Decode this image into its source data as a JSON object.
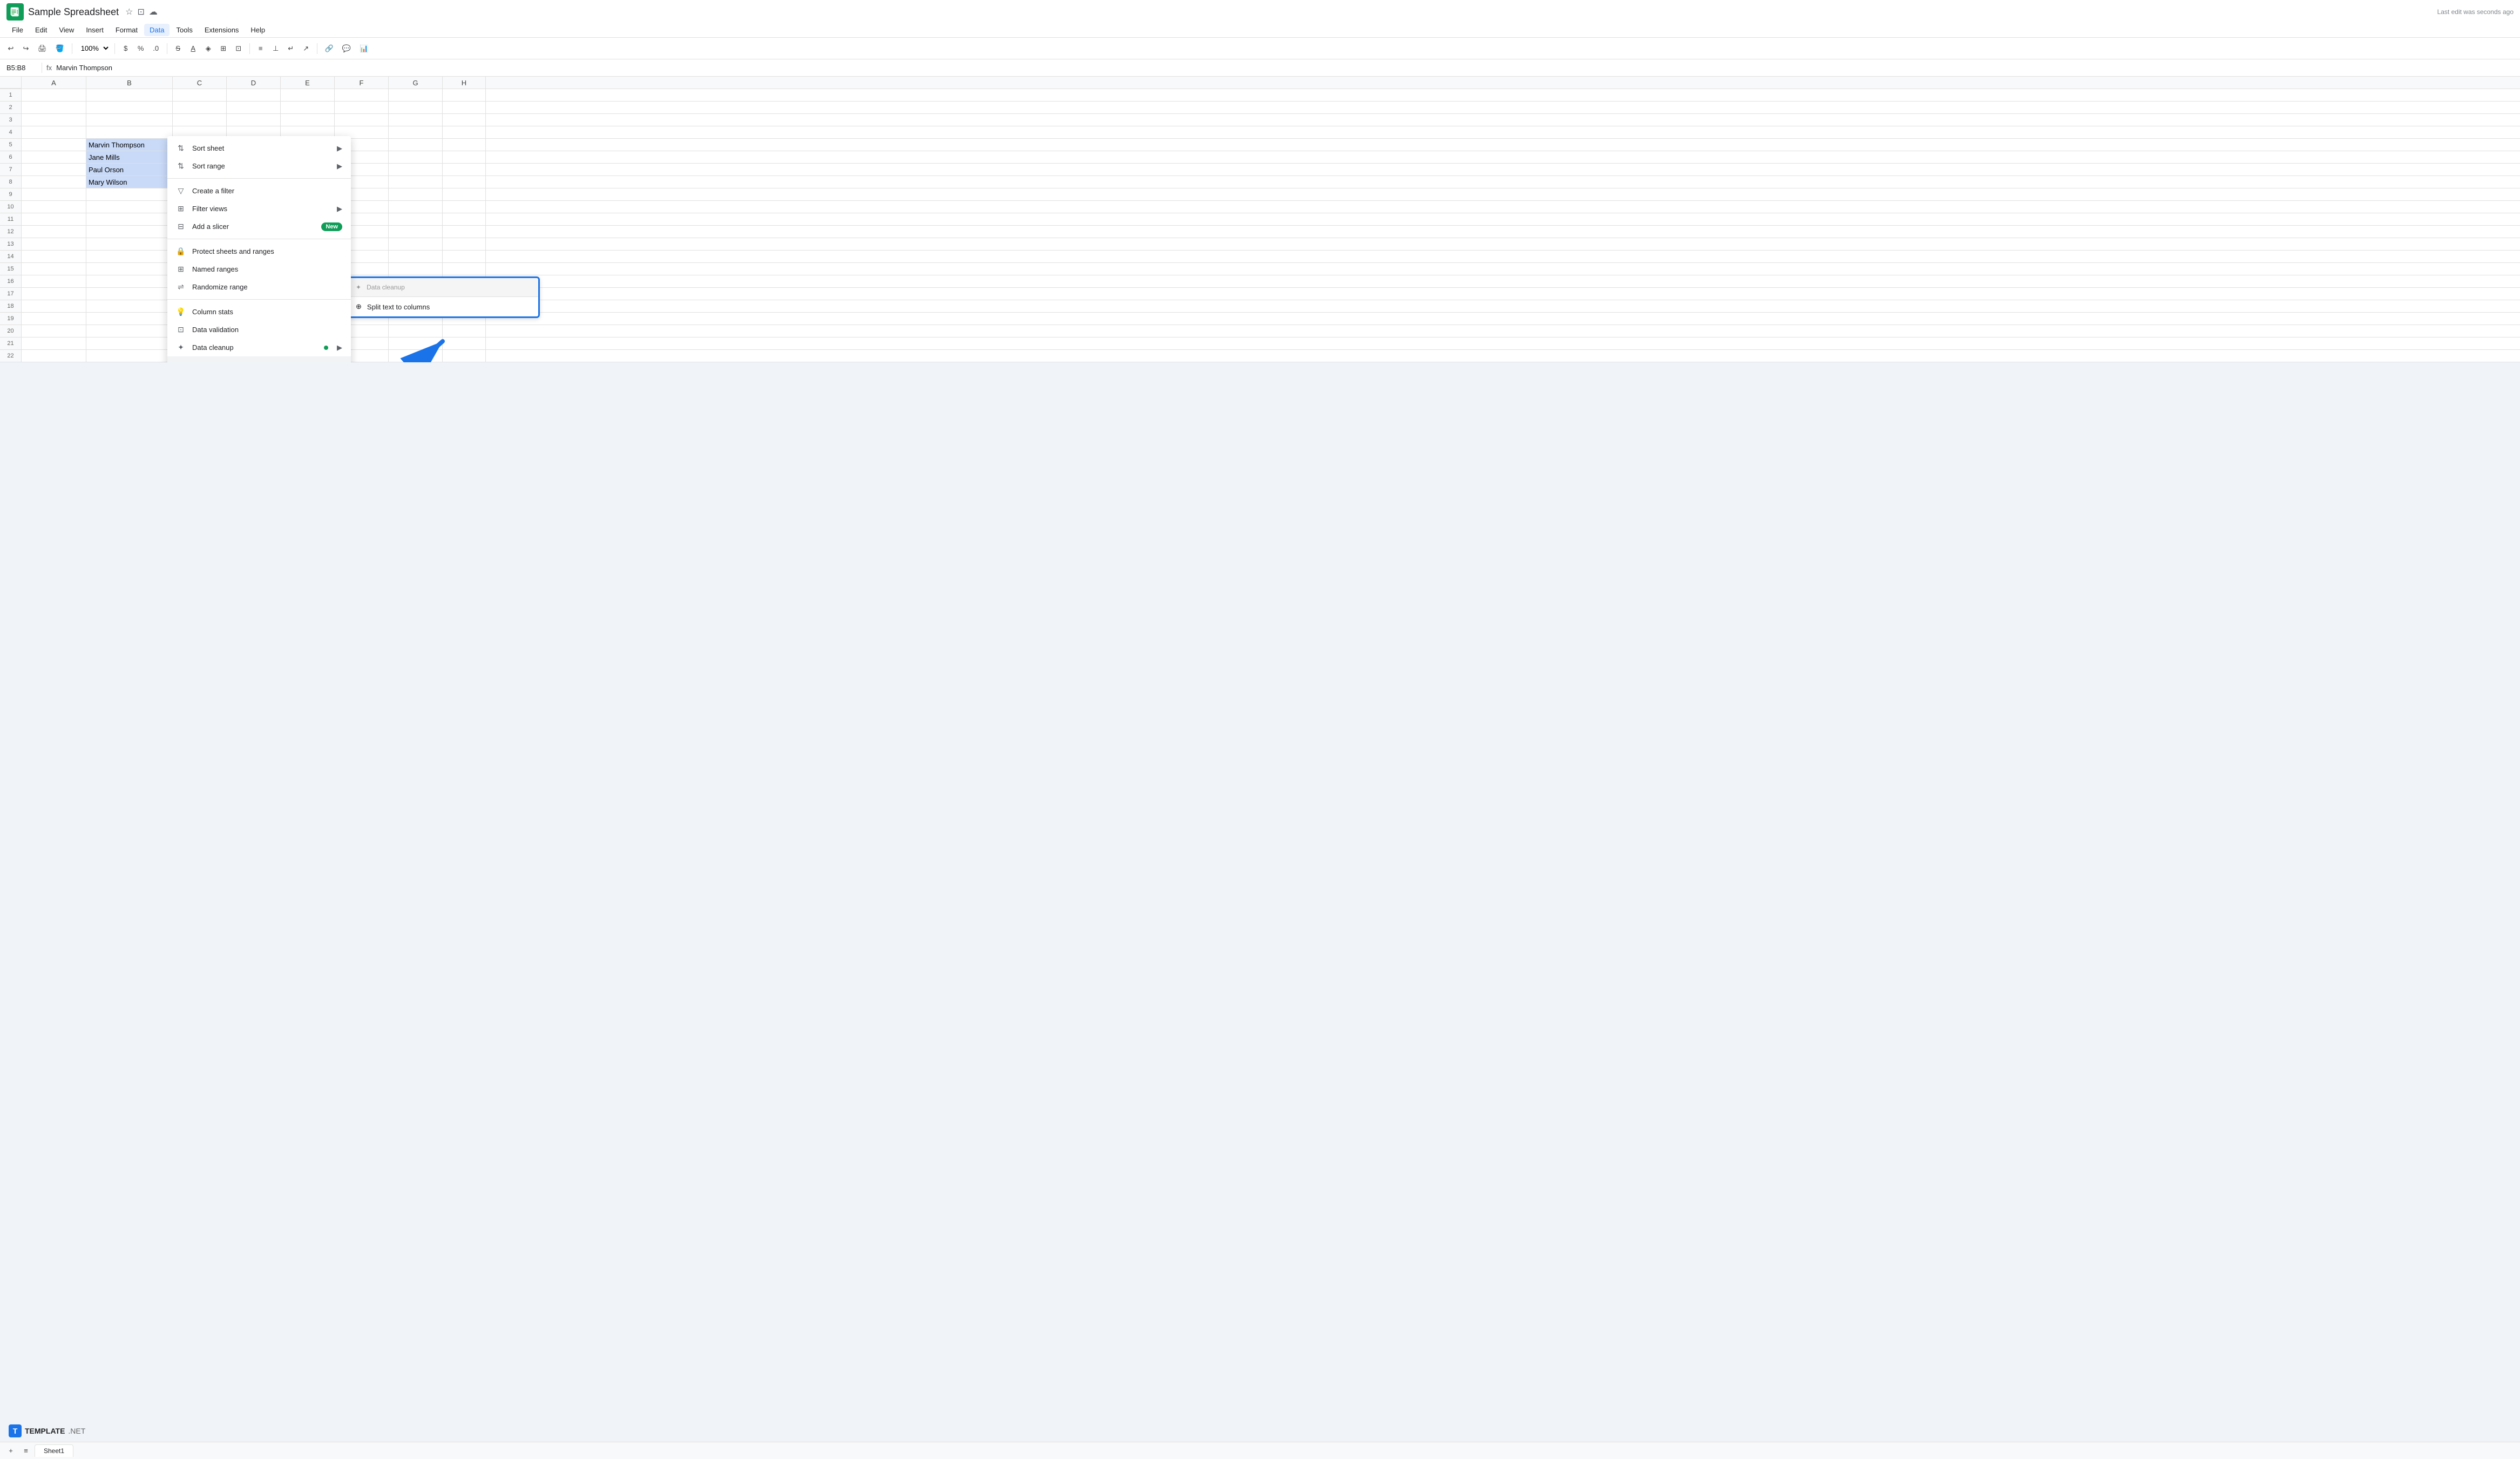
{
  "title": "Sample Spreadsheet",
  "last_edit": "Last edit was seconds ago",
  "menu": {
    "items": [
      "File",
      "Edit",
      "View",
      "Insert",
      "Format",
      "Data",
      "Tools",
      "Extensions",
      "Help"
    ],
    "active": "Data"
  },
  "toolbar": {
    "zoom": "100%"
  },
  "formula_bar": {
    "cell_ref": "B5:B8",
    "value": "Marvin Thompson"
  },
  "columns": [
    "A",
    "B",
    "C",
    "D",
    "E",
    "F",
    "G",
    "H"
  ],
  "rows": [
    {
      "num": 1,
      "b": ""
    },
    {
      "num": 2,
      "b": ""
    },
    {
      "num": 3,
      "b": ""
    },
    {
      "num": 4,
      "b": ""
    },
    {
      "num": 5,
      "b": "Marvin Thompson",
      "selected": true
    },
    {
      "num": 6,
      "b": "Jane Mills",
      "selected": true
    },
    {
      "num": 7,
      "b": "Paul Orson",
      "selected": true
    },
    {
      "num": 8,
      "b": "Mary Wilson",
      "selected": true
    },
    {
      "num": 9,
      "b": ""
    },
    {
      "num": 10,
      "b": ""
    },
    {
      "num": 11,
      "b": ""
    },
    {
      "num": 12,
      "b": ""
    },
    {
      "num": 13,
      "b": ""
    },
    {
      "num": 14,
      "b": ""
    },
    {
      "num": 15,
      "b": ""
    },
    {
      "num": 16,
      "b": ""
    },
    {
      "num": 17,
      "b": ""
    },
    {
      "num": 18,
      "b": ""
    },
    {
      "num": 19,
      "b": ""
    },
    {
      "num": 20,
      "b": ""
    },
    {
      "num": 21,
      "b": ""
    },
    {
      "num": 22,
      "b": ""
    }
  ],
  "data_menu": {
    "items": [
      {
        "id": "sort-sheet",
        "label": "Sort sheet",
        "icon": "sort",
        "arrow": true
      },
      {
        "id": "sort-range",
        "label": "Sort range",
        "icon": "sort",
        "arrow": true
      },
      {
        "id": "sep1"
      },
      {
        "id": "create-filter",
        "label": "Create a filter",
        "icon": "filter"
      },
      {
        "id": "filter-views",
        "label": "Filter views",
        "icon": "filter-views",
        "arrow": true
      },
      {
        "id": "add-slicer",
        "label": "Add a slicer",
        "icon": "slicer",
        "badge": "New"
      },
      {
        "id": "sep2"
      },
      {
        "id": "protect-sheets",
        "label": "Protect sheets and ranges",
        "icon": "lock"
      },
      {
        "id": "named-ranges",
        "label": "Named ranges",
        "icon": "grid"
      },
      {
        "id": "randomize",
        "label": "Randomize range",
        "icon": "shuffle"
      },
      {
        "id": "sep3"
      },
      {
        "id": "column-stats",
        "label": "Column stats",
        "icon": "bulb"
      },
      {
        "id": "data-validation",
        "label": "Data validation",
        "icon": "validation"
      },
      {
        "id": "data-cleanup",
        "label": "Data cleanup",
        "icon": "cleanup",
        "dot": true,
        "arrow": true
      },
      {
        "id": "split-text",
        "label": "Split text to columns",
        "icon": "split",
        "active": true
      }
    ]
  },
  "highlight_box": {
    "top_label": "Data cleanup",
    "main_label": "Split text to columns",
    "icon": "split"
  },
  "watermark": {
    "letter": "T",
    "brand": "TEMPLATE",
    "suffix": ".NET"
  },
  "sheet_tab": "Sheet1"
}
